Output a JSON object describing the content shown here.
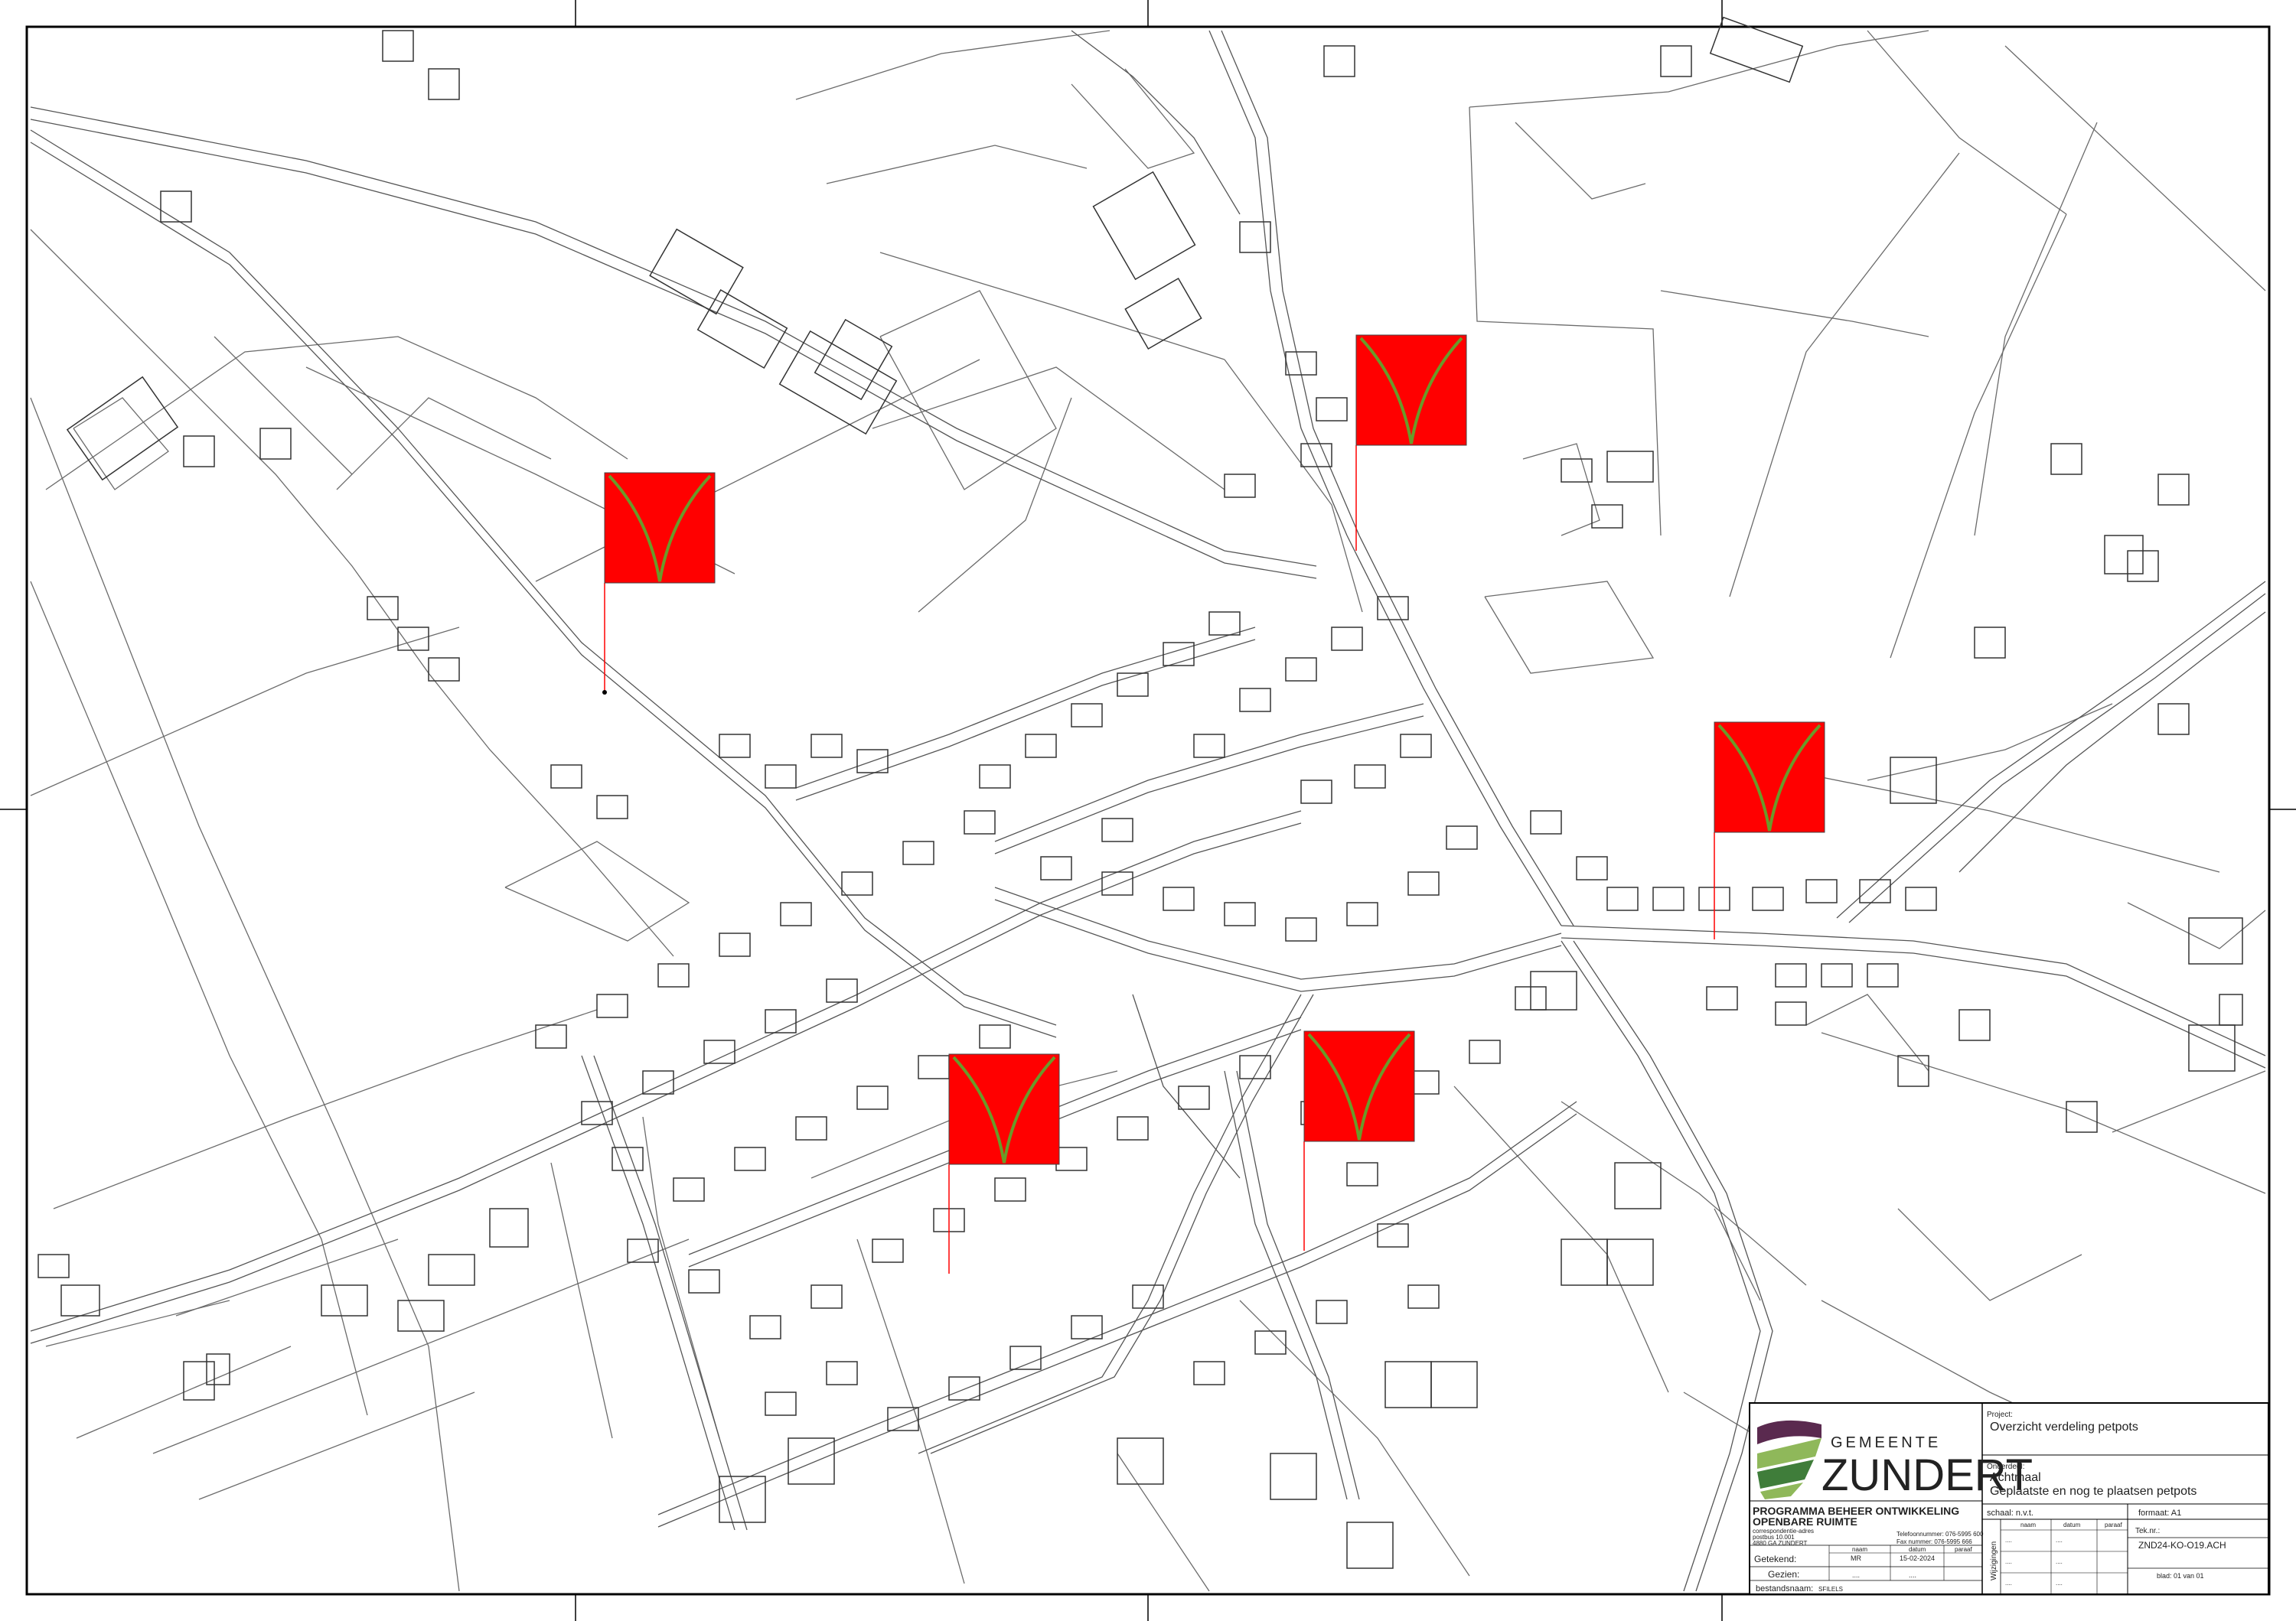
{
  "municipality": {
    "logo_top": "GEMEENTE",
    "logo_main": "ZUNDERT",
    "colors": {
      "purple": "#5a2a4f",
      "green_dark": "#3f7d3a",
      "green_light": "#8fb85a"
    }
  },
  "department": {
    "line1": "PROGRAMMA BEHEER ONTWIKKELING",
    "line2": "OPENBARE RUIMTE",
    "address1": "correspondentie-adres",
    "address2": "postbus 10.001",
    "address3": "4880 GA ZUNDERT",
    "phone_label": "Telefoonnummer: 076-5995 600",
    "fax_label": "Fax nummer: 076-5995 666"
  },
  "title_block": {
    "project_label": "Project:",
    "project_value": "Overzicht verdeling petpots",
    "onderdeel_label": "Onderdeel:",
    "onderdeel_value1": "Achtmaal",
    "onderdeel_value2": "Geplaatste en nog te plaatsen petpots",
    "schaal": "schaal: n.v.t.",
    "formaat": "formaat: A1",
    "tek_label": "Tek.nr.:",
    "tek_value": "ZND24-KO-O19.ACH",
    "blad": "blad: 01 van 01",
    "col_naam": "naam",
    "col_datum": "datum",
    "col_paraaf": "paraaf",
    "getekend_label": "Getekend:",
    "getekend_naam": "MR",
    "getekend_datum": "15-02-2024",
    "gezien_label": "Gezien:",
    "bestandsnaam_label": "bestandsnaam:",
    "bestandsnaam_value": "SFILELS",
    "wijzigingen_label": "Wijzigingen",
    "dash": "....",
    "rev_naam": "naam",
    "rev_datum": "datum",
    "rev_paraaf": "paraaf"
  },
  "markers": [
    {
      "id": "m1",
      "label": "petpot-marker"
    },
    {
      "id": "m2",
      "label": "petpot-marker"
    },
    {
      "id": "m3",
      "label": "petpot-marker"
    },
    {
      "id": "m4",
      "label": "petpot-marker"
    },
    {
      "id": "m5",
      "label": "petpot-marker"
    }
  ],
  "marker_colors": {
    "fill": "#ff0000",
    "symbol": "#6a9a2a",
    "leader": "#ff0000"
  }
}
